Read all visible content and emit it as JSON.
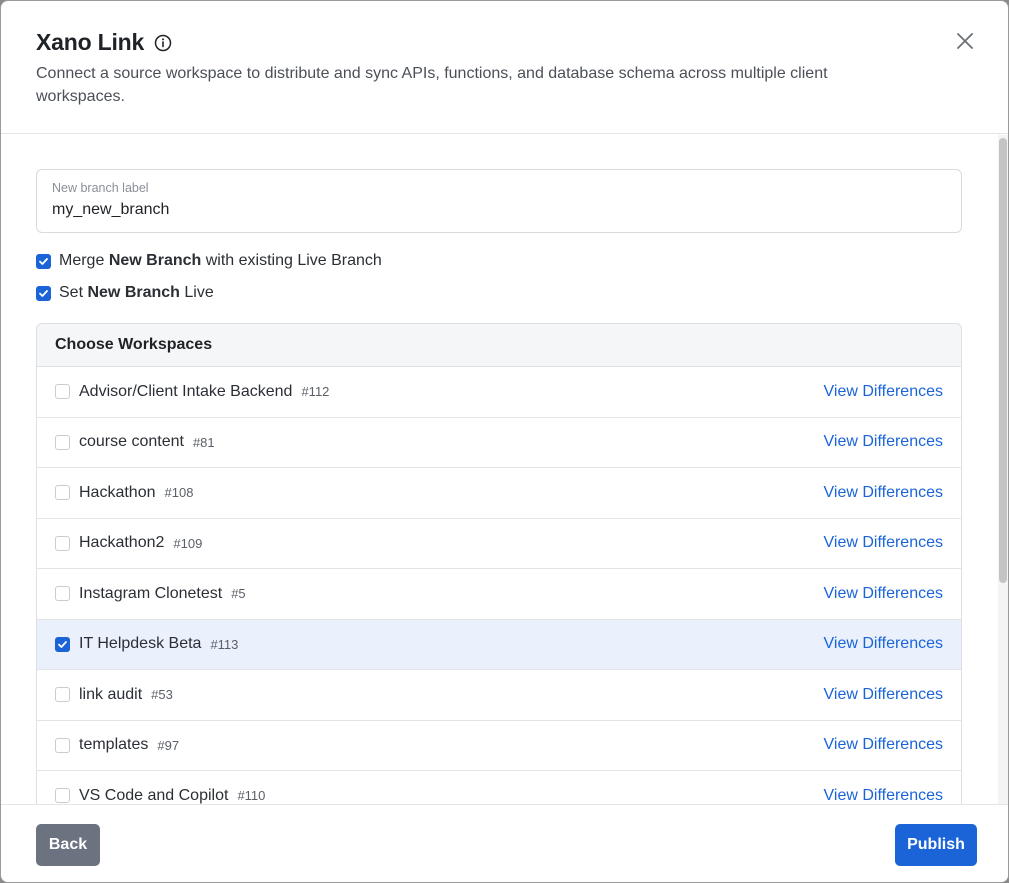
{
  "header": {
    "title": "Xano Link",
    "subtitle": "Connect a source workspace to distribute and sync APIs, functions, and database schema across multiple client workspaces."
  },
  "branch_field": {
    "label": "New branch label",
    "value": "my_new_branch"
  },
  "options": {
    "merge": {
      "checked": true,
      "prefix": "Merge",
      "bold": "New Branch",
      "suffix": "with existing Live Branch"
    },
    "set_live": {
      "checked": true,
      "prefix": "Set",
      "bold": "New Branch",
      "suffix": "Live"
    }
  },
  "workspaces": {
    "heading": "Choose Workspaces",
    "link_label": "View Differences",
    "items": [
      {
        "name": "Advisor/Client Intake Backend",
        "id": "#112",
        "checked": false
      },
      {
        "name": "course content",
        "id": "#81",
        "checked": false
      },
      {
        "name": "Hackathon",
        "id": "#108",
        "checked": false
      },
      {
        "name": "Hackathon2",
        "id": "#109",
        "checked": false
      },
      {
        "name": "Instagram Clonetest",
        "id": "#5",
        "checked": false
      },
      {
        "name": "IT Helpdesk Beta",
        "id": "#113",
        "checked": true
      },
      {
        "name": "link audit",
        "id": "#53",
        "checked": false
      },
      {
        "name": "templates",
        "id": "#97",
        "checked": false
      },
      {
        "name": "VS Code and Copilot",
        "id": "#110",
        "checked": false
      }
    ]
  },
  "footer": {
    "back_label": "Back",
    "publish_label": "Publish"
  },
  "colors": {
    "accent": "#1a64d8",
    "selected_row": "#eaf1fd",
    "back_button": "#6b7380"
  }
}
